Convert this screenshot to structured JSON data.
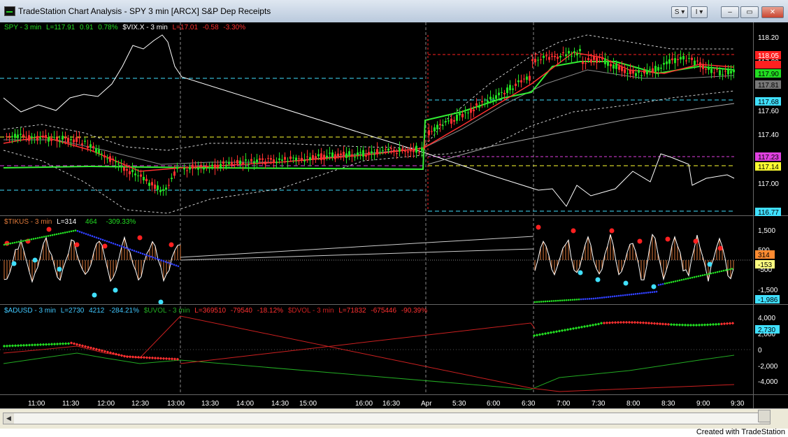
{
  "window": {
    "title": "TradeStation Chart Analysis - SPY 3 min [ARCX] S&P Dep Receipts",
    "buttons": [
      "S ▾",
      "I ▾",
      "‒",
      "▭",
      "✕"
    ]
  },
  "legends": {
    "price": [
      {
        "text": "SPY - 3 min",
        "color": "#22dd22"
      },
      {
        "text": "L=117.91",
        "color": "#22dd22"
      },
      {
        "text": "0.91",
        "color": "#22dd22"
      },
      {
        "text": "0.78%",
        "color": "#22dd22"
      },
      {
        "text": "$VIX.X - 3 min",
        "color": "#ffffff"
      },
      {
        "text": "L=17.01",
        "color": "#ff3030"
      },
      {
        "text": "-0.58",
        "color": "#ff3030"
      },
      {
        "text": "-3.30%",
        "color": "#ff3030"
      }
    ],
    "tick": [
      {
        "text": "$TIKUS - 3 min",
        "color": "#e07a3a"
      },
      {
        "text": "L=314",
        "color": "#ffffff"
      },
      {
        "text": "464",
        "color": "#22dd22"
      },
      {
        "text": "-309.33%",
        "color": "#22dd22"
      }
    ],
    "breadth": [
      {
        "text": "$ADUSD - 3 min",
        "color": "#40c8ff"
      },
      {
        "text": "L=2730",
        "color": "#40c8ff"
      },
      {
        "text": "4212",
        "color": "#40c8ff"
      },
      {
        "text": "-284.21%",
        "color": "#40c8ff"
      },
      {
        "text": "$UVOL - 3 min",
        "color": "#22aa22"
      },
      {
        "text": "L=369510",
        "color": "#ff3030"
      },
      {
        "text": "-79540",
        "color": "#ff3030"
      },
      {
        "text": "-18.12%",
        "color": "#ff3030"
      },
      {
        "text": "$DVOL - 3 min",
        "color": "#cc2020"
      },
      {
        "text": "L=71832",
        "color": "#ff3030"
      },
      {
        "text": "-675446",
        "color": "#ff3030"
      },
      {
        "text": "-90.39%",
        "color": "#ff3030"
      }
    ]
  },
  "axes": {
    "price_ticks": [
      "118.20",
      "117.80",
      "117.60",
      "117.40",
      "117.20",
      "117.00"
    ],
    "tick_ticks": [
      "1,500",
      "500",
      "-500",
      "-1,500"
    ],
    "breadth_ticks": [
      "4,000",
      "2,000",
      "0",
      "-2,000",
      "-4,000"
    ],
    "time_ticks": [
      "11:00",
      "11:30",
      "12:00",
      "12:30",
      "13:00",
      "13:30",
      "14:00",
      "14:30",
      "15:00",
      "16:00",
      "16:30",
      "Apr",
      "5:30",
      "6:00",
      "6:30",
      "7:00",
      "7:30",
      "8:00",
      "8:30",
      "9:00",
      "9:30"
    ]
  },
  "price_tags": [
    {
      "label": "118.05",
      "bg": "#ff2020",
      "fg": "#ffffff"
    },
    {
      "label": "117.90",
      "bg": "#22dd22",
      "fg": "#000000"
    },
    {
      "label": "117.81",
      "bg": "#777777",
      "fg": "#000000"
    },
    {
      "label": "117.68",
      "bg": "#40e0ff",
      "fg": "#000000"
    },
    {
      "label": "117.23",
      "bg": "#e040e0",
      "fg": "#000000"
    },
    {
      "label": "117.14",
      "bg": "#ffff30",
      "fg": "#000000"
    },
    {
      "label": "116.77",
      "bg": "#40e0ff",
      "fg": "#000000"
    }
  ],
  "tick_tags": [
    {
      "label": "314",
      "bg": "#ff8a30",
      "fg": "#000000"
    },
    {
      "label": "-153",
      "bg": "#ffff80",
      "fg": "#000000"
    },
    {
      "label": "-1,986",
      "bg": "#40e0ff",
      "fg": "#000000"
    }
  ],
  "breadth_tags": [
    {
      "label": "2,730",
      "bg": "#40e0ff",
      "fg": "#000000"
    }
  ],
  "colors": {
    "up_candle": "#22dd22",
    "down_candle": "#ff3030",
    "vix_line": "#ffffff",
    "axis_text": "#ffffff",
    "background": "#000000"
  },
  "footer": {
    "credit": "Created with TradeStation"
  }
}
